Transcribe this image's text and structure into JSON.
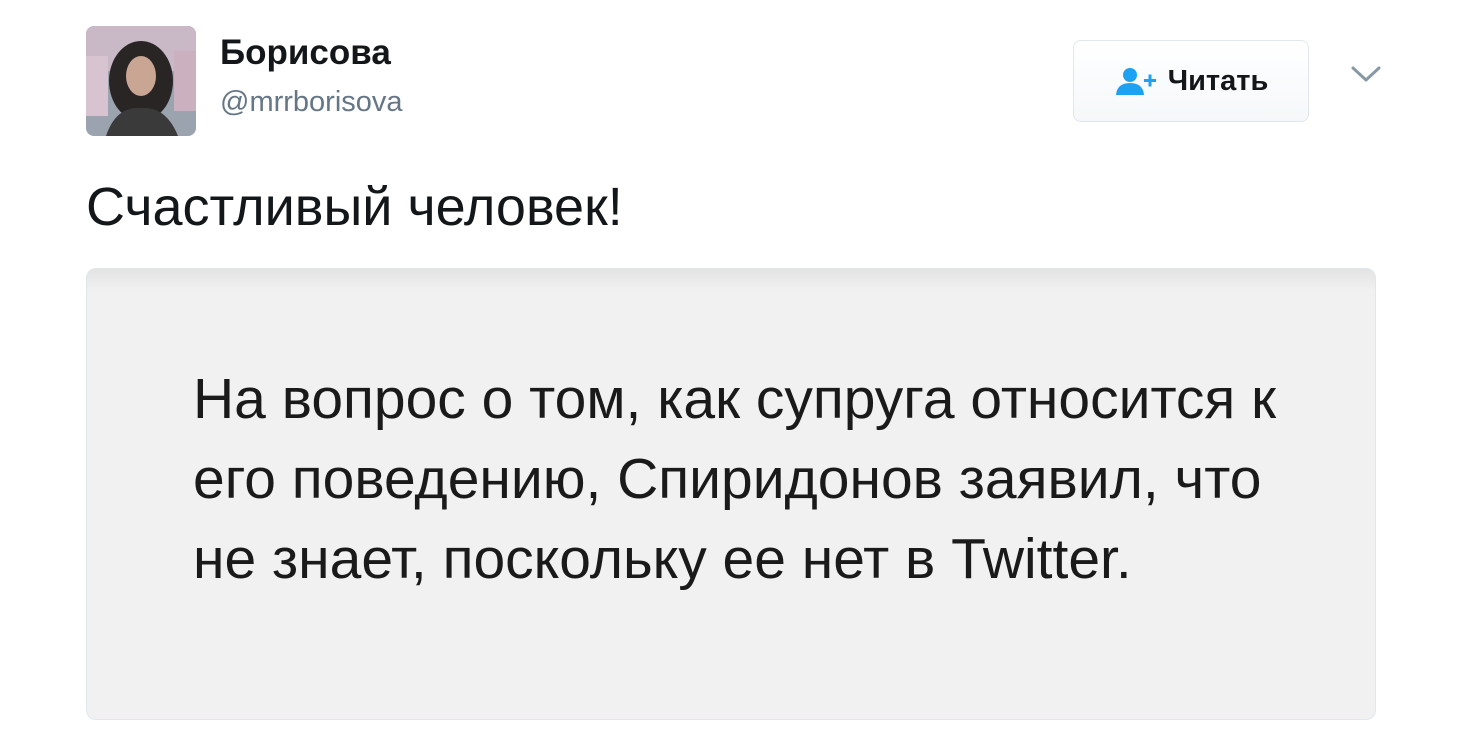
{
  "tweet": {
    "author": {
      "display_name": "Борисова",
      "screen_name": "@mrrborisova",
      "avatar_icon": "user-avatar"
    },
    "follow_button": {
      "label": "Читать",
      "icon": "add-user-icon",
      "icon_color": "#1da1f2"
    },
    "menu_icon": "chevron-down-icon",
    "text": "Счастливый человек!",
    "media": {
      "text": "На вопрос о том, как супруга относится к его поведению, Спиридонов заявил, что не знает, поскольку ее нет в Twitter.",
      "background": "#f1f1f1"
    }
  },
  "colors": {
    "primary_text": "#14171a",
    "secondary_text": "#657786",
    "accent": "#1da1f2"
  }
}
